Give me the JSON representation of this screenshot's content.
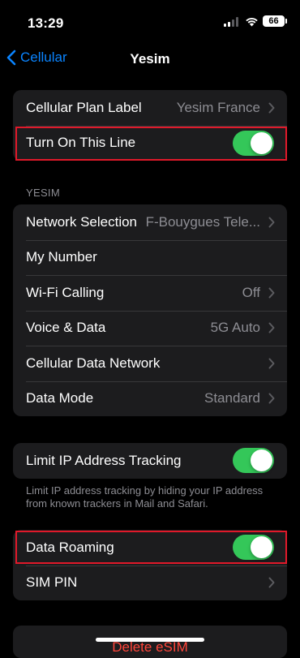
{
  "status": {
    "time": "13:29",
    "battery": "66"
  },
  "nav": {
    "back_label": "Cellular",
    "title": "Yesim"
  },
  "group1": {
    "plan_label": "Cellular Plan Label",
    "plan_value": "Yesim France",
    "turn_on_label": "Turn On This Line",
    "turn_on_state": "on"
  },
  "section_header": "YESIM",
  "group2": {
    "rows": [
      {
        "label": "Network Selection",
        "value": "F-Bouygues Tele..."
      },
      {
        "label": "My Number",
        "value": ""
      },
      {
        "label": "Wi-Fi Calling",
        "value": "Off"
      },
      {
        "label": "Voice & Data",
        "value": "5G Auto"
      },
      {
        "label": "Cellular Data Network",
        "value": ""
      },
      {
        "label": "Data Mode",
        "value": "Standard"
      }
    ]
  },
  "group3": {
    "limit_ip_label": "Limit IP Address Tracking",
    "limit_ip_state": "on",
    "footer": "Limit IP address tracking by hiding your IP address from known trackers in Mail and Safari."
  },
  "group4": {
    "roaming_label": "Data Roaming",
    "roaming_state": "on",
    "sim_pin_label": "SIM PIN"
  },
  "delete_label": "Delete eSIM",
  "colors": {
    "accent": "#0a84ff",
    "toggle_on": "#34c759",
    "destructive": "#ff453a",
    "highlight": "#e0192a"
  }
}
